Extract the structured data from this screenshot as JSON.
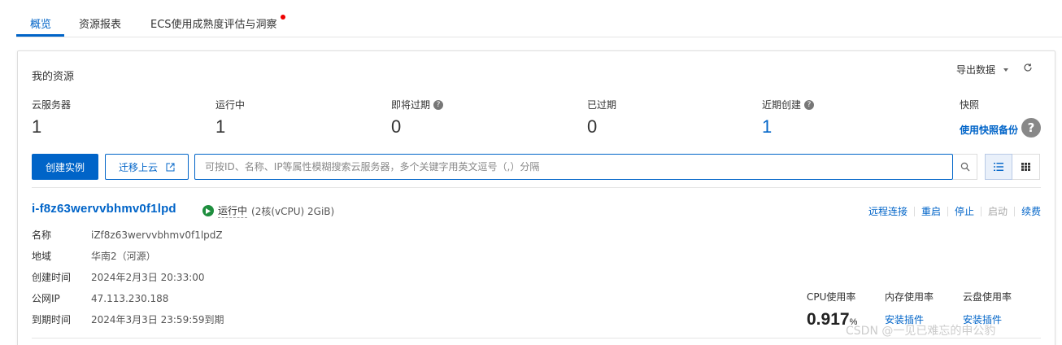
{
  "tabs": [
    {
      "label": "概览"
    },
    {
      "label": "资源报表"
    },
    {
      "label": "ECS使用成熟度评估与洞察"
    }
  ],
  "card": {
    "title": "我的资源",
    "export_label": "导出数据"
  },
  "stats": [
    {
      "label": "云服务器",
      "value": "1"
    },
    {
      "label": "运行中",
      "value": "1"
    },
    {
      "label": "即将过期",
      "value": "0"
    },
    {
      "label": "已过期",
      "value": "0"
    },
    {
      "label": "近期创建",
      "value": "1"
    }
  ],
  "snapshot": {
    "label": "快照",
    "link": "使用快照备份"
  },
  "toolbar": {
    "create_label": "创建实例",
    "migrate_label": "迁移上云",
    "search_placeholder": "可按ID、名称、IP等属性模糊搜索云服务器，多个关键字用英文逗号（,）分隔"
  },
  "instance": {
    "id": "i-f8z63wervvbhmv0f1lpd",
    "status": "运行中",
    "spec": "(2核(vCPU) 2GiB)",
    "actions": [
      "远程连接",
      "重启",
      "停止",
      "启动",
      "续费"
    ],
    "fields": [
      {
        "key": "名称",
        "value": "iZf8z63wervvbhmv0f1lpdZ"
      },
      {
        "key": "地域",
        "value": "华南2（河源）"
      },
      {
        "key": "创建时间",
        "value": "2024年2月3日 20:33:00"
      },
      {
        "key": "公网IP",
        "value": "47.113.230.188"
      },
      {
        "key": "到期时间",
        "value": "2024年3月3日 23:59:59到期"
      }
    ],
    "metrics": {
      "cpu_label": "CPU使用率",
      "mem_label": "内存使用率",
      "disk_label": "云盘使用率",
      "cpu_value": "0.917",
      "cpu_unit": "%",
      "mem_link": "安装插件",
      "disk_link": "安装插件"
    }
  },
  "watermark": "CSDN @一见已难忘的申公豹",
  "colors": {
    "accent": "#0064c8",
    "running": "#1e8e3e",
    "new_dot": "#e00000"
  }
}
